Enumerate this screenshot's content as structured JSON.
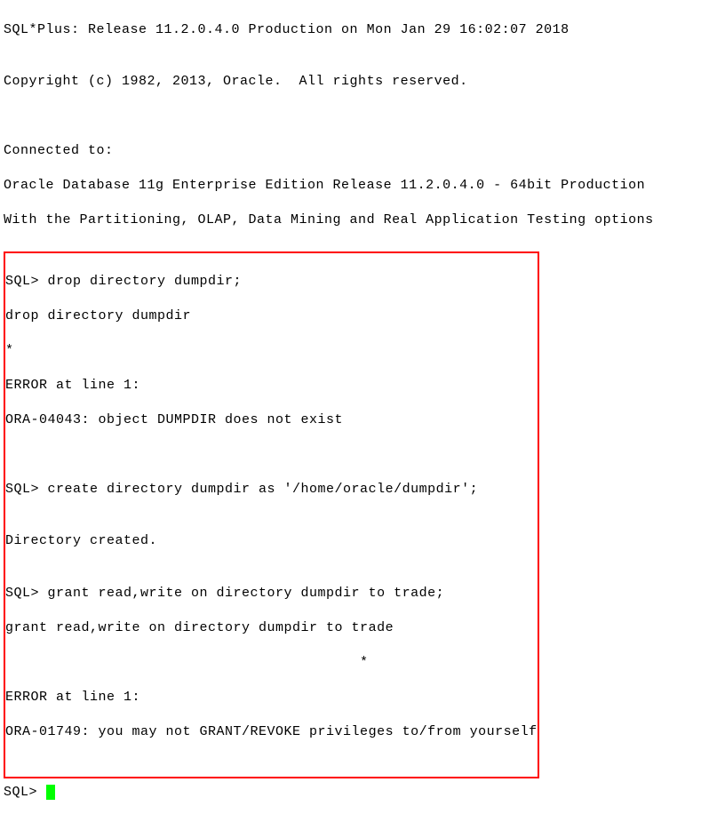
{
  "header": {
    "line1": "SQL*Plus: Release 11.2.0.4.0 Production on Mon Jan 29 16:02:07 2018",
    "line2": "",
    "line3": "Copyright (c) 1982, 2013, Oracle.  All rights reserved.",
    "line4": "",
    "line5": "",
    "line6": "Connected to:",
    "line7": "Oracle Database 11g Enterprise Edition Release 11.2.0.4.0 - 64bit Production",
    "line8": "With the Partitioning, OLAP, Data Mining and Real Application Testing options"
  },
  "session": {
    "b1": "SQL> drop directory dumpdir;",
    "b2": "drop directory dumpdir",
    "b3": "*",
    "b4": "ERROR at line 1:",
    "b5": "ORA-04043: object DUMPDIR does not exist",
    "b6": "",
    "b7": "",
    "b8": "SQL> create directory dumpdir as '/home/oracle/dumpdir';",
    "b9": "",
    "b10": "Directory created.",
    "b11": "",
    "b12": "SQL> grant read,write on directory dumpdir to trade;",
    "b13": "grant read,write on directory dumpdir to trade",
    "b14": "                                          *",
    "b15": "ERROR at line 1:",
    "b16": "ORA-01749: you may not GRANT/REVOKE privileges to/from yourself",
    "b17": ""
  },
  "footer": {
    "prompt": "SQL> "
  }
}
